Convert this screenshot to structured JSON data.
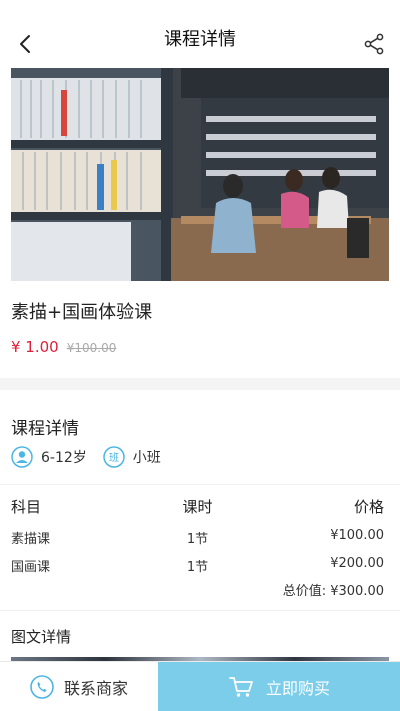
{
  "header": {
    "title": "课程详情"
  },
  "course": {
    "title": "素描+国画体验课",
    "price_now": "¥ 1.00",
    "price_old": "¥100.00"
  },
  "details": {
    "section_title": "课程详情",
    "age": "6-12岁",
    "class_type": "小班",
    "class_icon_char": "班",
    "table": {
      "headers": [
        "科目",
        "课时",
        "价格"
      ],
      "rows": [
        [
          "素描课",
          "1节",
          "¥100.00"
        ],
        [
          "国画课",
          "1节",
          "¥200.00"
        ]
      ],
      "total": "总价值: ¥300.00"
    }
  },
  "graphic": {
    "section_title": "图文详情"
  },
  "bottom_bar": {
    "contact_label": "联系商家",
    "buy_label": "立即购买"
  },
  "colors": {
    "accent": "#7ccde9",
    "price": "#e0203a",
    "icon_blue": "#4bb6e3"
  }
}
